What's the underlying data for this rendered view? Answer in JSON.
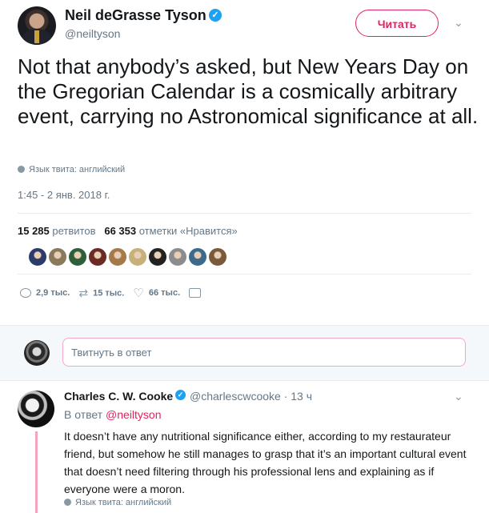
{
  "tweet": {
    "author_name": "Neil deGrasse Tyson",
    "verified_glyph": "✓",
    "author_handle": "@neiltyson",
    "follow_label": "Читать",
    "chevron": "⌄",
    "text": "Not that anybody’s asked, but New Years Day on the Gregorian Calendar is a cosmically arbitrary event, carrying no Astronomical significance at all.",
    "language_note": "Язык твита: английский",
    "timestamp": "1:45 - 2 янв. 2018 г.",
    "retweets_count": "15 285",
    "retweets_label": "ретвитов",
    "likes_count": "66 353",
    "likes_label": "отметки «Нравится»",
    "likers": [
      {
        "name": "liker-1",
        "color": "#2d3b6b"
      },
      {
        "name": "liker-2",
        "color": "#8a7a5c"
      },
      {
        "name": "liker-3",
        "color": "#2f5f3a"
      },
      {
        "name": "liker-4",
        "color": "#6b2a24"
      },
      {
        "name": "liker-5",
        "color": "#a47a4a"
      },
      {
        "name": "liker-6",
        "color": "#c8b07a"
      },
      {
        "name": "liker-7",
        "color": "#222222"
      },
      {
        "name": "liker-8",
        "color": "#8c8c8c"
      },
      {
        "name": "liker-9",
        "color": "#3b6a8a"
      },
      {
        "name": "liker-10",
        "color": "#7a5a3a"
      }
    ],
    "actions": {
      "replies": "2,9 тыс.",
      "retweets": "15 тыс.",
      "likes": "66 тыс."
    }
  },
  "composer": {
    "placeholder": "Твитнуть в ответ"
  },
  "reply": {
    "author_name": "Charles C. W. Cooke",
    "verified_glyph": "✓",
    "author_handle": "@charlescwcooke · 13 ч",
    "in_reply_prefix": "В ответ",
    "in_reply_handle": "@neiltyson",
    "text": "It doesn’t have any nutritional significance either, according to my restaurateur friend, but somehow he still manages to grasp that it’s an important cultural event that doesn’t need filtering through his professional lens and explaining as if everyone were a moron.",
    "language_note": "Язык твита: английский"
  },
  "icons": {
    "reply": "reply-icon",
    "retweet": "retweet-icon",
    "like": "heart-icon",
    "dm": "envelope-icon",
    "globe": "globe-icon",
    "verified": "verified-badge-icon"
  },
  "colors": {
    "accent": "#e0245e",
    "verified": "#1da1f2",
    "secondary_text": "#657786"
  }
}
